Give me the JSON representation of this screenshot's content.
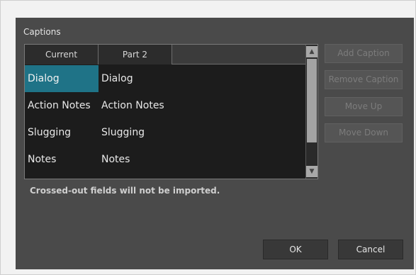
{
  "dialog": {
    "group_label": "Captions",
    "table": {
      "columns": [
        "Current",
        "Part 2"
      ],
      "rows": [
        [
          "Dialog",
          "Dialog"
        ],
        [
          "Action Notes",
          "Action Notes"
        ],
        [
          "Slugging",
          "Slugging"
        ],
        [
          "Notes",
          "Notes"
        ]
      ],
      "selected_cell": "Dialog"
    },
    "side_buttons": {
      "add": "Add Caption",
      "remove": "Remove Caption",
      "move_up": "Move Up",
      "move_down": "Move Down"
    },
    "note": "Crossed-out fields will not be imported.",
    "ok_label": "OK",
    "cancel_label": "Cancel",
    "icons": {
      "scroll_up": "chevron-up-icon",
      "scroll_down": "chevron-down-icon"
    },
    "colors": {
      "background": "#4a4a4a",
      "selection": "#1f7387"
    }
  }
}
